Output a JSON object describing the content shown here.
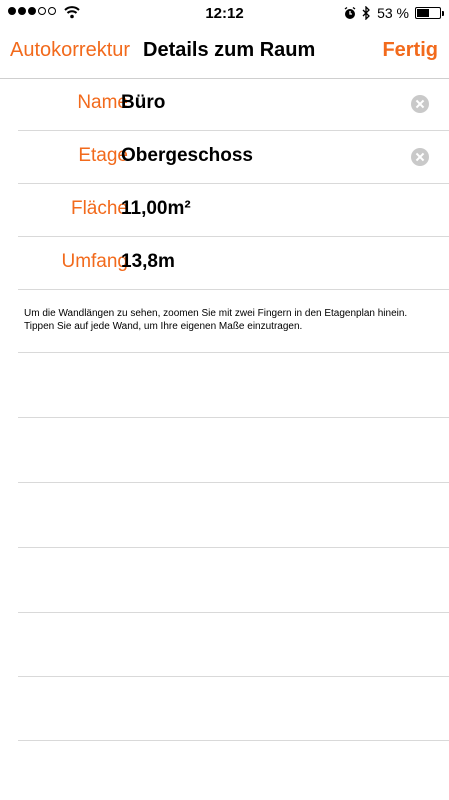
{
  "status_bar": {
    "signal_bars_filled": 3,
    "signal_bars_total": 5,
    "wifi_icon": "wifi-icon",
    "time": "12:12",
    "alarm_icon": "alarm-icon",
    "bluetooth_icon": "bluetooth-icon",
    "battery_percent_text": "53 %",
    "battery_level": 0.53
  },
  "nav": {
    "left_label": "Autokorrektur",
    "title": "Details zum Raum",
    "right_label": "Fertig",
    "accent_color": "#f26a1c"
  },
  "fields": [
    {
      "label": "Name",
      "value": "Büro",
      "clearable": true
    },
    {
      "label": "Etage",
      "value": "Obergeschoss",
      "clearable": true
    },
    {
      "label": "Fläche",
      "value": "11,00m²",
      "clearable": false
    },
    {
      "label": "Umfang",
      "value": "13,8m",
      "clearable": false
    }
  ],
  "info_text": "Um die Wandlängen zu sehen, zoomen Sie mit zwei Fingern in den Etagenplan hinein. Tippen Sie auf jede Wand, um Ihre eigenen Maße einzutragen."
}
